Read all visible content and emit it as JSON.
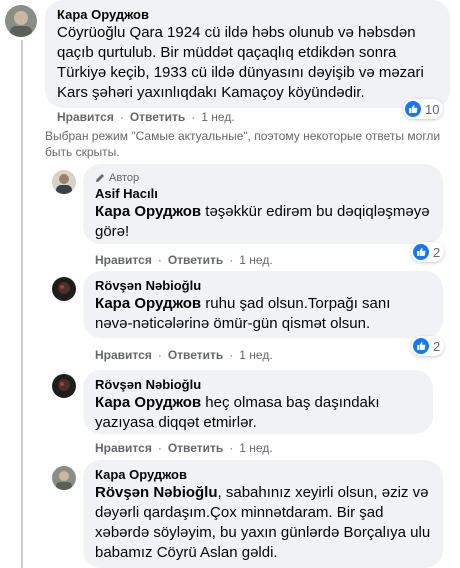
{
  "comments": [
    {
      "author": "Кара Оруджов",
      "text": "Cöyrüoğlu Qara 1924 cü ildə həbs olunub və həbsdən qaçıb qurtulub. Bir müddət qaçaqlıq etdikdən sonra Türkiyə keçib, 1933 cü ildə dünyasını dəyişib və məzari Kars şəhəri yaxınlıqdakı Kamaçoy köyündədir.",
      "like_label": "Нравится",
      "reply_label": "Ответить",
      "time": "1 нед.",
      "reaction_count": "10"
    }
  ],
  "notice": "Выбран режим \"Самые актуальные\", поэтому некоторые ответы могли быть скрыты.",
  "replies": [
    {
      "badge": "Автор",
      "author": "Asif Hacılı",
      "mention": "Кара Оруджов",
      "text": " təşəkkür edirəm bu dəqiqləşməyə görə!",
      "like_label": "Нравится",
      "reply_label": "Ответить",
      "time": "1 нед.",
      "reaction_count": "2"
    },
    {
      "author": "Rövşən Nəbioğlu",
      "mention": "Кара Оруджов",
      "text": " ruhu şad olsun.Torpağı sanı nəvə-nəticələrinə ömür-gün qismət olsun.",
      "like_label": "Нравится",
      "reply_label": "Ответить",
      "time": "1 нед.",
      "reaction_count": "2"
    },
    {
      "author": "Rövşən Nəbioğlu",
      "mention": "Кара Оруджов",
      "text": " heç olmasa baş daşındakı yazıyasa diqqət etmirlər.",
      "like_label": "Нравится",
      "reply_label": "Ответить",
      "time": "1 нед."
    },
    {
      "author": "Кара Оруджов",
      "mention": "Rövşən Nəbioğlu",
      "text": ", sabahınız xeyirli olsun, əziz və dəyərli qardaşım.Çox minnətdaram. Bir şad xəbərdə söyləyim, bu yaxın günlərdə Borçalıya ulu babamız Cöyrü Aslan gəldi."
    }
  ],
  "colors": {
    "bubble": "#f0f2f5",
    "like_blue": "#1877f2",
    "muted": "#65676b"
  }
}
